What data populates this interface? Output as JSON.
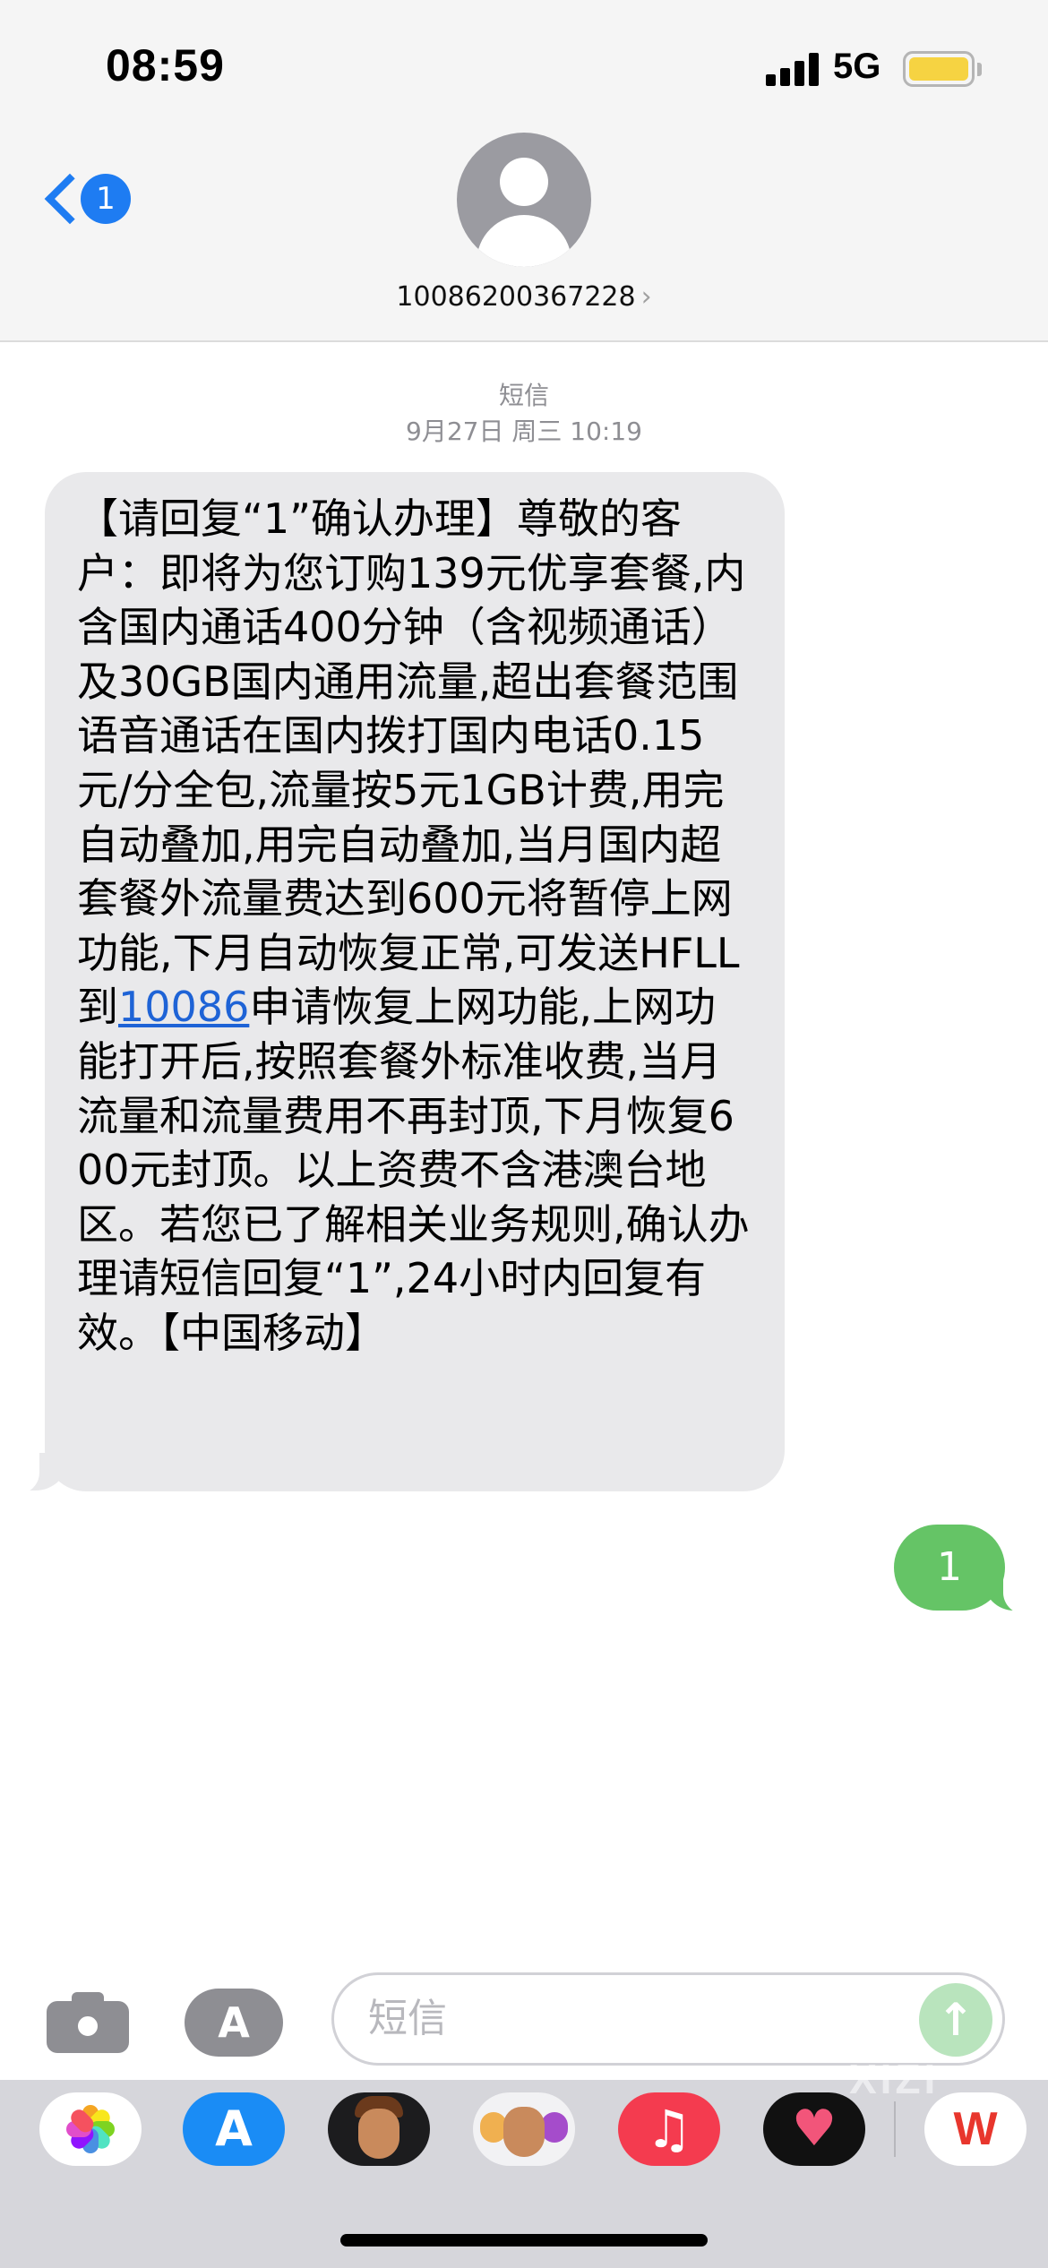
{
  "status_bar": {
    "time": "08:59",
    "network": "5G",
    "battery_color": "#f6d342"
  },
  "header": {
    "back_badge": "1",
    "contact_number": "10086200367228",
    "contact_chevron": "›"
  },
  "thread": {
    "service_label": "短信",
    "timestamp": "9月27日 周三 10:19",
    "incoming": {
      "text_before_link": "【请回复“1”确认办理】尊敬的客户：即将为您订购139元优享套餐,内含国内通话400分钟（含视频通话）及30GB国内通用流量,超出套餐范围语音通话在国内拨打国内电话0.15元/分全包,流量按5元1GB计费,用完自动叠加,用完自动叠加,当月国内超套餐外流量费达到600元将暂停上网功能,下月自动恢复正常,可发送HFLL到",
      "link": "10086",
      "text_after_link": "申请恢复上网功能,上网功能打开后,按照套餐外标准收费,当月流量和流量费用不再封顶,下月恢复600元封顶。以上资费不含港澳台地区。若您已了解相关业务规则,确认办理请短信回复“1”,24小时内回复有效。【中国移动】",
      "bubble_color": "#e9e9eb",
      "link_color": "#1e63d6"
    },
    "outgoing": {
      "text": "1",
      "bubble_color": "#65c466"
    }
  },
  "composer": {
    "placeholder": "短信",
    "camera_icon": "camera-icon",
    "apps_icon": "app-store-icon",
    "send_icon": "arrow-up-icon"
  },
  "app_drawer": {
    "apps": [
      "photos-icon",
      "app-store-icon",
      "memoji-icon",
      "memoji-stickers-icon",
      "music-icon",
      "heart-app-icon",
      "wps-icon"
    ],
    "wps_label": "W",
    "watermark": "XIZI"
  }
}
